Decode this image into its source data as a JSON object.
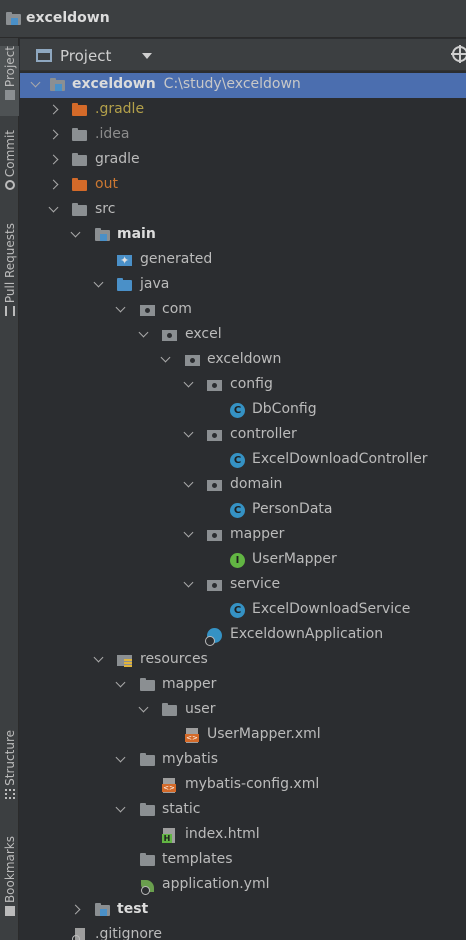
{
  "window": {
    "title": "exceldown"
  },
  "toolstrip": {
    "project": "Project",
    "commit": "Commit",
    "pull_requests": "Pull Requests",
    "structure": "Structure",
    "bookmarks": "Bookmarks"
  },
  "panel": {
    "title": "Project"
  },
  "tree": {
    "root_name": "exceldown",
    "root_path": "C:\\study\\exceldown",
    "items": [
      {
        "label": ".gradle"
      },
      {
        "label": ".idea"
      },
      {
        "label": "gradle"
      },
      {
        "label": "out"
      },
      {
        "label": "src"
      },
      {
        "label": "main"
      },
      {
        "label": "generated"
      },
      {
        "label": "java"
      },
      {
        "label": "com"
      },
      {
        "label": "excel"
      },
      {
        "label": "exceldown"
      },
      {
        "label": "config"
      },
      {
        "label": "DbConfig"
      },
      {
        "label": "controller"
      },
      {
        "label": "ExcelDownloadController"
      },
      {
        "label": "domain"
      },
      {
        "label": "PersonData"
      },
      {
        "label": "mapper"
      },
      {
        "label": "UserMapper"
      },
      {
        "label": "service"
      },
      {
        "label": "ExcelDownloadService"
      },
      {
        "label": "ExceldownApplication"
      },
      {
        "label": "resources"
      },
      {
        "label": "mapper"
      },
      {
        "label": "user"
      },
      {
        "label": "UserMapper.xml"
      },
      {
        "label": "mybatis"
      },
      {
        "label": "mybatis-config.xml"
      },
      {
        "label": "static"
      },
      {
        "label": "index.html"
      },
      {
        "label": "templates"
      },
      {
        "label": "application.yml"
      },
      {
        "label": "test"
      },
      {
        "label": ".gitignore"
      }
    ]
  }
}
